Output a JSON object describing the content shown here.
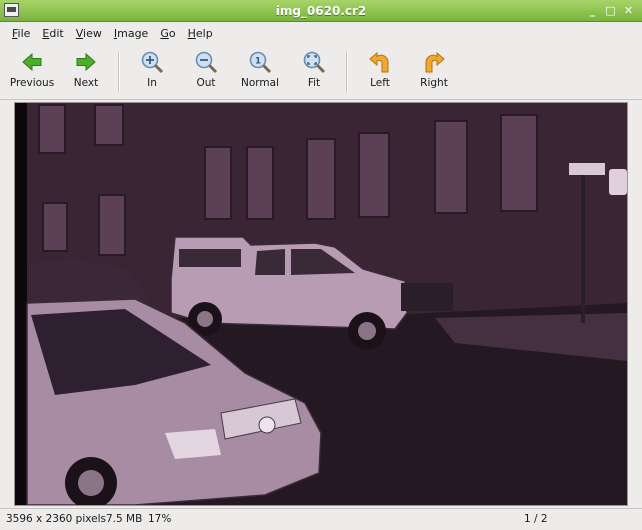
{
  "window": {
    "title": "img_0620.cr2",
    "buttons": {
      "minimize": "_",
      "maximize": "□",
      "close": "✕"
    }
  },
  "menubar": {
    "items": [
      {
        "label": "File",
        "mnemonic": "F",
        "rest": "ile"
      },
      {
        "label": "Edit",
        "mnemonic": "E",
        "rest": "dit"
      },
      {
        "label": "View",
        "mnemonic": "V",
        "rest": "iew"
      },
      {
        "label": "Image",
        "mnemonic": "I",
        "rest": "mage"
      },
      {
        "label": "Go",
        "mnemonic": "G",
        "rest": "o"
      },
      {
        "label": "Help",
        "mnemonic": "H",
        "rest": "elp"
      }
    ]
  },
  "toolbar": {
    "previous": "Previous",
    "next": "Next",
    "zoom_in": "In",
    "zoom_out": "Out",
    "normal": "Normal",
    "fit": "Fit",
    "rotate_left": "Left",
    "rotate_right": "Right"
  },
  "statusbar": {
    "dimensions": "3596 x 2360 pixels",
    "size": "7.5 MB",
    "zoom": "17%",
    "position": "1 / 2"
  },
  "colors": {
    "titlebar": "#8cc450",
    "nav_arrow": "#4caf2c",
    "zoom_icon": "#8ab0d8",
    "rotate_icon": "#f0a830",
    "photo_tint": "#3a2538"
  },
  "icons": {
    "previous": "arrow-left-icon",
    "next": "arrow-right-icon",
    "zoom_in": "zoom-in-icon",
    "zoom_out": "zoom-out-icon",
    "normal": "zoom-normal-icon",
    "fit": "zoom-fit-icon",
    "rotate_left": "rotate-left-icon",
    "rotate_right": "rotate-right-icon"
  }
}
